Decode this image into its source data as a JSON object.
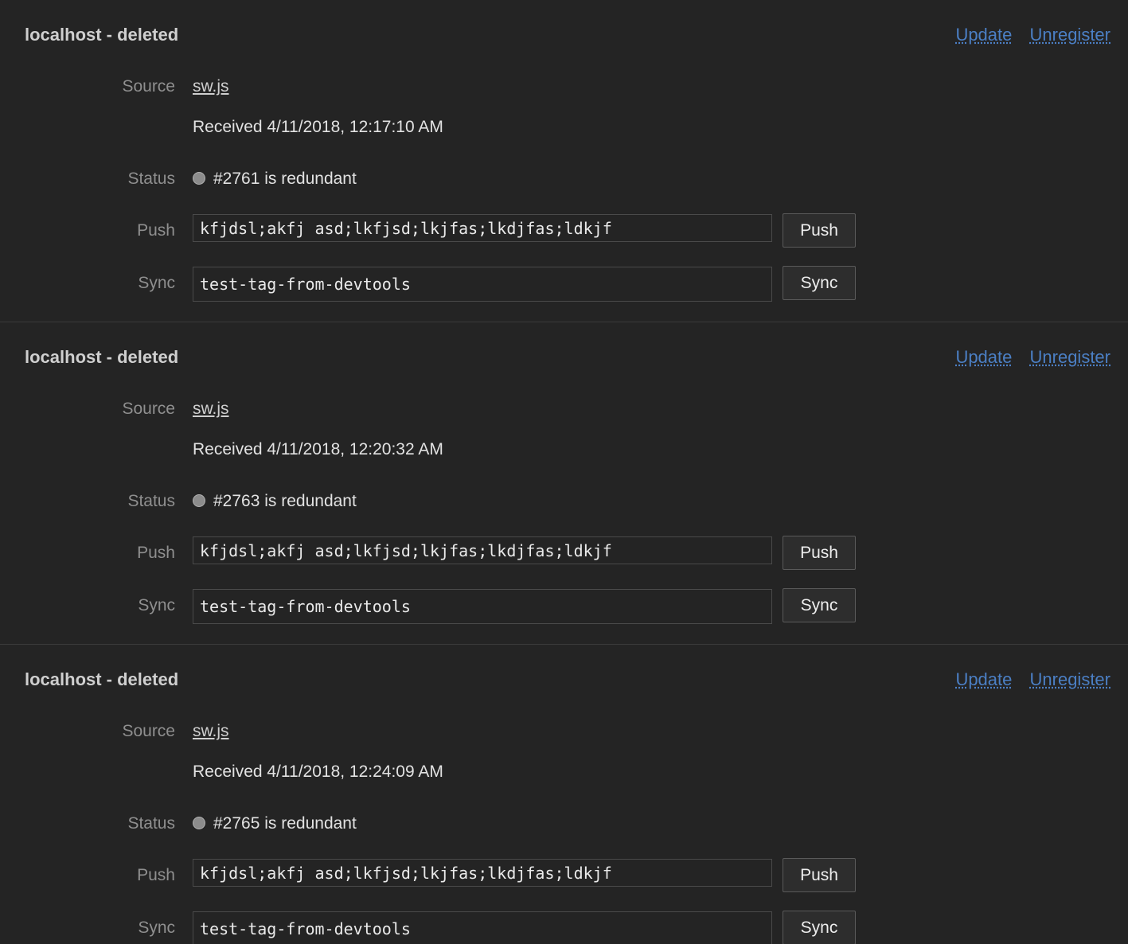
{
  "labels": {
    "source": "Source",
    "status": "Status",
    "push": "Push",
    "sync": "Sync"
  },
  "actions": {
    "update": "Update",
    "unregister": "Unregister",
    "push_button": "Push",
    "sync_button": "Sync"
  },
  "registrations": [
    {
      "title": "localhost - deleted",
      "source": "sw.js",
      "received": "Received 4/11/2018, 12:17:10 AM",
      "status": "#2761 is redundant",
      "push_value": "kfjdsl;akfj asd;lkfjsd;lkjfas;lkdjfas;ldkjf",
      "sync_value": "test-tag-from-devtools"
    },
    {
      "title": "localhost - deleted",
      "source": "sw.js",
      "received": "Received 4/11/2018, 12:20:32 AM",
      "status": "#2763 is redundant",
      "push_value": "kfjdsl;akfj asd;lkfjsd;lkjfas;lkdjfas;ldkjf",
      "sync_value": "test-tag-from-devtools"
    },
    {
      "title": "localhost - deleted",
      "source": "sw.js",
      "received": "Received 4/11/2018, 12:24:09 AM",
      "status": "#2765 is redundant",
      "push_value": "kfjdsl;akfj asd;lkfjsd;lkjfas;lkdjfas;ldkjf",
      "sync_value": "test-tag-from-devtools"
    }
  ]
}
